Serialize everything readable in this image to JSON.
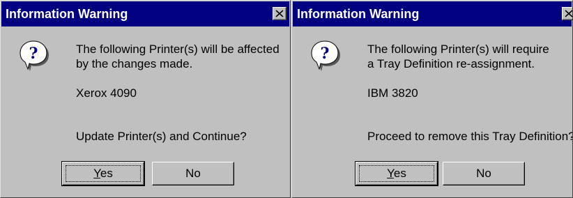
{
  "dialogs": [
    {
      "title": "Information Warning",
      "icon": "question-icon",
      "message_line1": "The following Printer(s) will be affected",
      "message_line2": "by the changes made.",
      "printer": "Xerox 4090",
      "question": "Update Printer(s) and Continue?",
      "yes_label": "Yes",
      "no_label": "No"
    },
    {
      "title": "Information Warning",
      "icon": "question-icon",
      "message_line1": "The following Printer(s) will require",
      "message_line2": "a Tray Definition re-assignment.",
      "printer": "IBM 3820",
      "question": "Proceed to remove this Tray Definition?",
      "yes_label": "Yes",
      "no_label": "No"
    }
  ],
  "colors": {
    "titlebar": "#000080",
    "face": "#c0c0c0",
    "icon_bubble": "#ffffff",
    "icon_mark": "#000080"
  }
}
